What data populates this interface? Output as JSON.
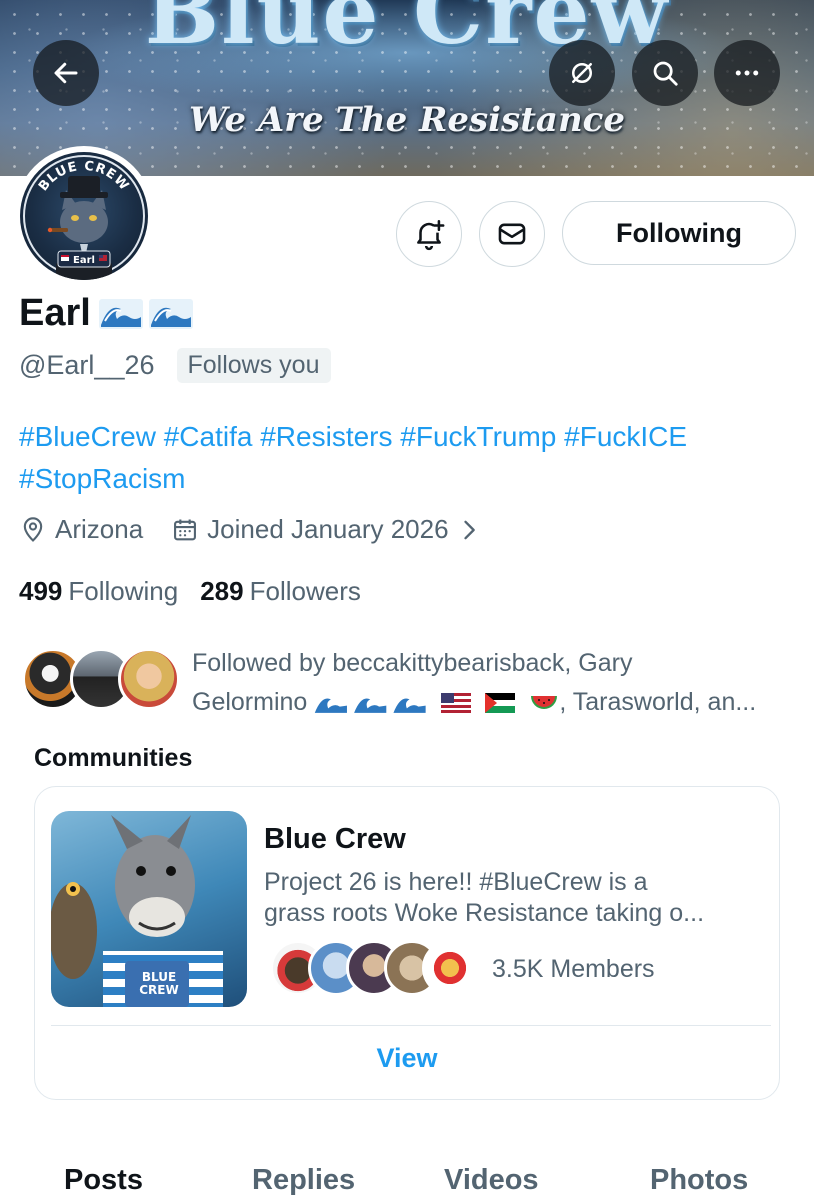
{
  "banner": {
    "title": "Blue Crew",
    "tagline": "We Are The Resistance"
  },
  "header_buttons": {
    "back": "back-arrow-icon",
    "hide": "eye-slash-icon",
    "search": "search-icon",
    "more": "more-icon"
  },
  "avatar": {
    "ring_text": "BLUE CREW",
    "name_plate": "Earl"
  },
  "actions": {
    "notify_icon": "bell-plus-icon",
    "message_icon": "envelope-icon",
    "following_label": "Following"
  },
  "profile": {
    "name": "Earl",
    "handle": "@Earl__26",
    "follows_you": "Follows you",
    "bio_line1": "#BlueCrew #Catifa #Resisters #FuckTrump #FuckICE",
    "bio_line2": "#StopRacism",
    "location": "Arizona",
    "joined": "Joined January 2026"
  },
  "stats": {
    "following_count": "499",
    "following_label": "Following",
    "followers_count": "289",
    "followers_label": "Followers"
  },
  "followed_by": {
    "line1": "Followed by beccakittybearisback, Gary",
    "line2_name": "Gelormino",
    "line2_rest": ", Tarasworld, an..."
  },
  "communities": {
    "title": "Communities",
    "card": {
      "name": "Blue Crew",
      "description_line1": "Project 26 is here!! #BlueCrew is a",
      "description_line2": "grass roots Woke Resistance taking o...",
      "members": "3.5K Members",
      "view_label": "View",
      "image_text": "BLUE CREW"
    }
  },
  "tabs": [
    "Posts",
    "Replies",
    "Videos",
    "Photos"
  ],
  "colors": {
    "accent": "#1d9bf0",
    "text_primary": "#0f1419",
    "text_secondary": "#536471",
    "border": "#cfd9de"
  }
}
